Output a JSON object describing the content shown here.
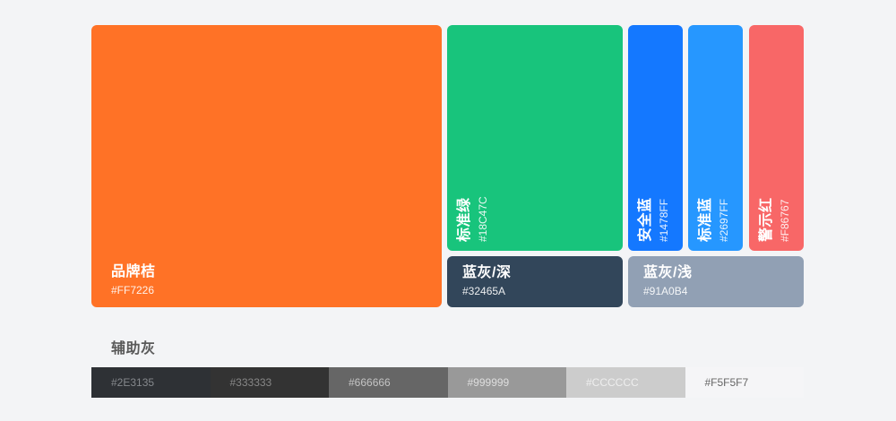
{
  "main_palette": [
    {
      "name": "品牌桔",
      "hex": "#FF7226"
    },
    {
      "name": "标准绿",
      "hex": "#18C47C"
    },
    {
      "name": "蓝灰/深",
      "hex": "#32465A"
    },
    {
      "name": "安全蓝",
      "hex": "#1478FF"
    },
    {
      "name": "标准蓝",
      "hex": "#2697FF"
    },
    {
      "name": "警示红",
      "hex": "#F86767"
    },
    {
      "name": "蓝灰/浅",
      "hex": "#91A0B4"
    }
  ],
  "auxiliary_gray": {
    "title": "辅助灰",
    "swatches": [
      "#2E3135",
      "#333333",
      "#666666",
      "#999999",
      "#CCCCCC",
      "#F5F5F7"
    ]
  }
}
